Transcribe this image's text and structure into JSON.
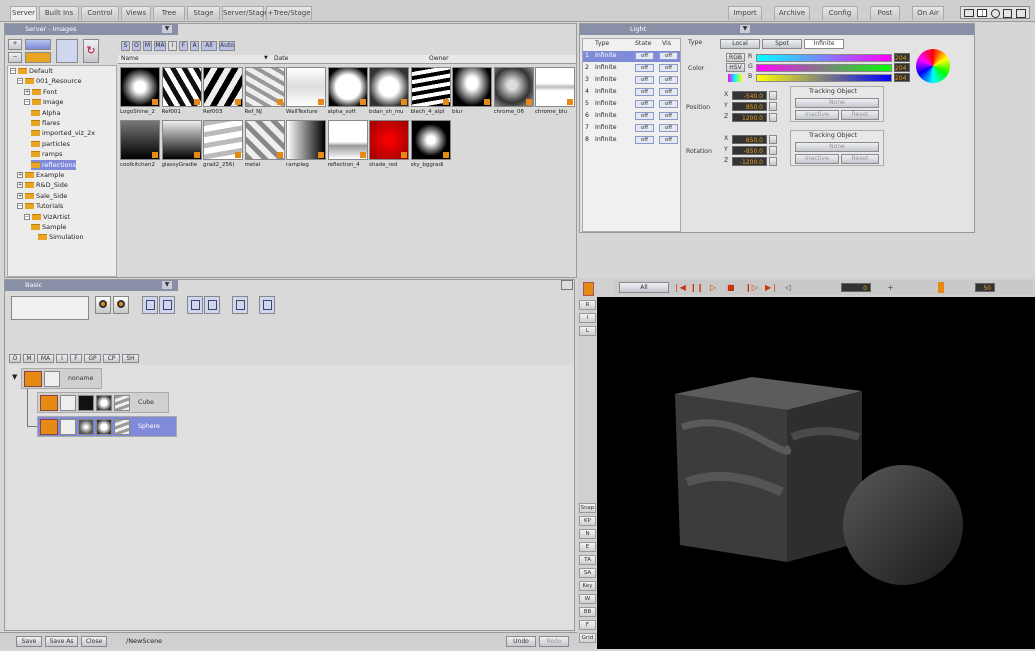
{
  "menubar": {
    "left_tabs": [
      "Server",
      "Built Ins",
      "Control",
      "Views",
      "Tree",
      "Stage",
      "Server/Stage",
      "+Tree/Stage"
    ],
    "right_tabs": [
      "Import",
      "Archive",
      "Config",
      "Post",
      "On Air"
    ]
  },
  "server_panel": {
    "title": "Server - Images",
    "filter_tabs": [
      "S",
      "O",
      "M",
      "MA",
      "I",
      "F",
      "A",
      "All",
      "Auto"
    ],
    "columns": {
      "name": "Name",
      "date": "Date",
      "owner": "Owner"
    },
    "tree": [
      {
        "label": "Default",
        "indent": 0
      },
      {
        "label": "001_Resource",
        "indent": 1
      },
      {
        "label": "Font",
        "indent": 2
      },
      {
        "label": "Image",
        "indent": 2
      },
      {
        "label": "Alpha",
        "indent": 3
      },
      {
        "label": "flares",
        "indent": 3
      },
      {
        "label": "imported_viz_2x",
        "indent": 3
      },
      {
        "label": "particles",
        "indent": 3
      },
      {
        "label": "ramps",
        "indent": 3
      },
      {
        "label": "reflections",
        "indent": 3
      },
      {
        "label": "Example",
        "indent": 1
      },
      {
        "label": "R&D_Side",
        "indent": 1
      },
      {
        "label": "Sale_Side",
        "indent": 1
      },
      {
        "label": "Tutorials",
        "indent": 1
      },
      {
        "label": "VizArtist",
        "indent": 2
      },
      {
        "label": "Sample",
        "indent": 3
      },
      {
        "label": "Simulation",
        "indent": 4
      }
    ],
    "thumbs_row1": [
      "LogoShine_2",
      "Ref001",
      "Ref003",
      "Ref_NJ",
      "WallTexture",
      "alpha_soft",
      "bdan_sh_mu",
      "blech_4_alpl",
      "blur",
      "chrome_06",
      "chrome_blu"
    ],
    "thumbs_row2": [
      "coolkitchen2",
      "glassyGradie",
      "grad2_256(",
      "metal",
      "rampleg",
      "reflection_4",
      "shade_red",
      "sky_bggradi"
    ]
  },
  "light_panel": {
    "title": "Light",
    "table_headers": {
      "type": "Type",
      "state": "State",
      "vis": "Vis"
    },
    "rows": [
      {
        "num": "1",
        "type": "Infinite",
        "state": "off",
        "vis": "off"
      },
      {
        "num": "2",
        "type": "Infinite",
        "state": "off",
        "vis": "off"
      },
      {
        "num": "3",
        "type": "Infinite",
        "state": "off",
        "vis": "off"
      },
      {
        "num": "4",
        "type": "Infinite",
        "state": "off",
        "vis": "off"
      },
      {
        "num": "5",
        "type": "Infinite",
        "state": "off",
        "vis": "off"
      },
      {
        "num": "6",
        "type": "Infinite",
        "state": "off",
        "vis": "off"
      },
      {
        "num": "7",
        "type": "Infinite",
        "state": "off",
        "vis": "off"
      },
      {
        "num": "8",
        "type": "Infinite",
        "state": "off",
        "vis": "off"
      }
    ],
    "type_label": "Type",
    "type_tabs": [
      "Local",
      "Spot",
      "Infinite"
    ],
    "color_label": "Color",
    "color_modes": [
      "RGB",
      "HSV"
    ],
    "channels": [
      {
        "ch": "R",
        "val": "204"
      },
      {
        "ch": "G",
        "val": "204"
      },
      {
        "ch": "B",
        "val": "204"
      }
    ],
    "position_label": "Position",
    "position": [
      {
        "axis": "X",
        "val": "-540.0"
      },
      {
        "axis": "Y",
        "val": "850.0"
      },
      {
        "axis": "Z",
        "val": "1200.0"
      }
    ],
    "rotation_label": "Rotation",
    "rotation": [
      {
        "axis": "X",
        "val": "650.0"
      },
      {
        "axis": "Y",
        "val": "-850.0"
      },
      {
        "axis": "Z",
        "val": "-1200.0"
      }
    ],
    "tracking_label": "Tracking Object",
    "tracking_none": "None",
    "inactive": "Inactive",
    "reset": "Reset"
  },
  "scene_panel": {
    "title": "Basic",
    "tabs": [
      "O",
      "M",
      "MA",
      "I",
      "F",
      "GP",
      "CP",
      "SH"
    ],
    "nodes": [
      {
        "label": "noname"
      },
      {
        "label": "Cube"
      },
      {
        "label": "Sphere"
      }
    ]
  },
  "bottombar": {
    "buttons": [
      "Save",
      "Save As",
      "Close"
    ],
    "scene_path": "/NewScene",
    "undo": "Undo",
    "redo": "Redo"
  },
  "stage": {
    "all_label": "All",
    "frame_value": "0",
    "keyframe_value": "50",
    "side_buttons_top": [
      "R",
      "I",
      "L"
    ],
    "side_buttons_bottom": [
      "Snap",
      "KP",
      "N",
      "E",
      "TA",
      "SA",
      "Key",
      "W",
      "BB",
      "F",
      "Grid"
    ]
  }
}
